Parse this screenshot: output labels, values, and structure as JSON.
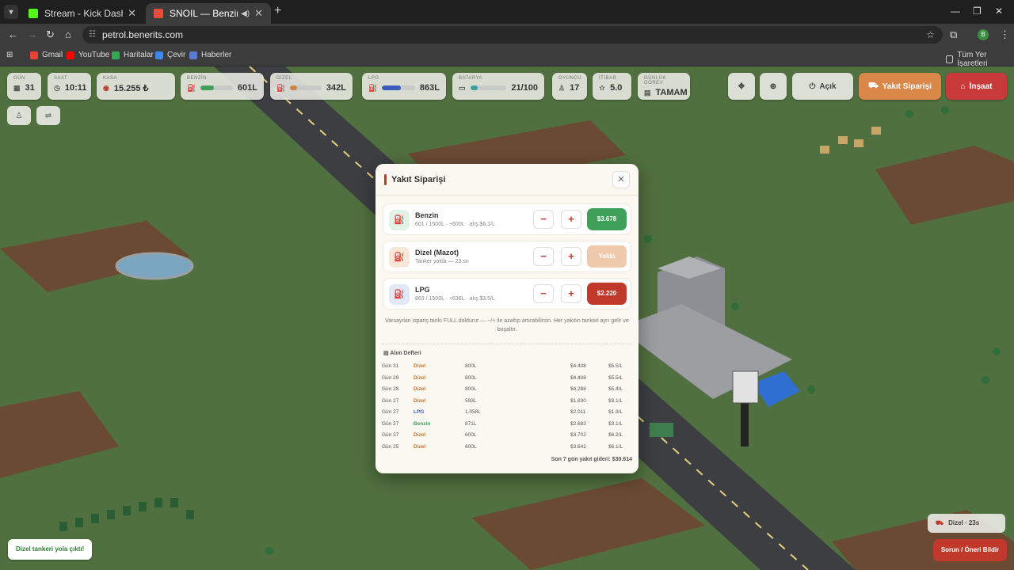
{
  "browser": {
    "tabs": [
      {
        "title": "Stream - Kick Dashboard",
        "active": false
      },
      {
        "title": "SNOIL — Benzinlik",
        "active": true
      }
    ],
    "url": "petrol.benerits.com",
    "profile_initial": "B",
    "bookmarks": [
      "Gmail",
      "YouTube",
      "Haritalar",
      "Çevir",
      "Haberler"
    ],
    "bookmarks_right": "Tüm Yer İşaretleri"
  },
  "hud": {
    "day": {
      "label": "GÜN",
      "value": "31"
    },
    "time": {
      "label": "SAAT",
      "value": "10:11"
    },
    "cash": {
      "label": "KASA",
      "value": "15.255 ₺"
    },
    "benzin": {
      "label": "BENZİN",
      "value": "601L",
      "level": 0.4,
      "color": "#3fa05a"
    },
    "dizel": {
      "label": "DİZEL",
      "value": "342L",
      "level": 0.23,
      "color": "#c8864a"
    },
    "lpg": {
      "label": "LPG",
      "value": "863L",
      "level": 0.58,
      "color": "#3b5bbf"
    },
    "battery": {
      "label": "BATARYA",
      "value": "21/100",
      "level": 0.21,
      "color": "#3ba0a0"
    },
    "players": {
      "label": "OYUNCU",
      "value": "17"
    },
    "reputation": {
      "label": "İTİBAR",
      "value": "5.0"
    },
    "daily": {
      "label": "GÜNLÜK GÖREV",
      "value": "TAMAM"
    },
    "open_label": "Açık",
    "fuel_order_label": "Yakıt Siparişi",
    "build_label": "İnşaat"
  },
  "modal": {
    "title": "Yakıt Siparişi",
    "fuels": [
      {
        "name": "Benzin",
        "sub": "601 / 1500L · +600L · alış $6.1/L",
        "buy": "$3.678",
        "buy_color": "#3fa05a",
        "icon_bg": "#e3f2e6"
      },
      {
        "name": "Dizel (Mazot)",
        "sub": "Tanker yolda — 23 sn",
        "buy": "Yolda",
        "buy_color": "#efc9ab",
        "icon_bg": "#f8e6d8"
      },
      {
        "name": "LPG",
        "sub": "863 / 1500L · +636L · alış $3.5/L",
        "buy": "$2.220",
        "buy_color": "#c0392b",
        "icon_bg": "#e3e8f6"
      }
    ],
    "note": "Varsayılan sipariş tankı FULL doldurur — −/+ ile azaltıp artırabilirsin. Her yakıtın tankeri ayrı gelir ve boşaltır.",
    "ledger_title": "Alım Defteri",
    "ledger": [
      {
        "day": "Gün 31",
        "fuel": "Dizel",
        "liters": "800L",
        "price": "$4.408",
        "unit": "$5.5/L"
      },
      {
        "day": "Gün 29",
        "fuel": "Dizel",
        "liters": "800L",
        "price": "$4.408",
        "unit": "$5.5/L"
      },
      {
        "day": "Gün 28",
        "fuel": "Dizel",
        "liters": "800L",
        "price": "$4.288",
        "unit": "$5.4/L"
      },
      {
        "day": "Gün 27",
        "fuel": "Dizel",
        "liters": "593L",
        "price": "$1.830",
        "unit": "$3.1/L"
      },
      {
        "day": "Gün 27",
        "fuel": "LPG",
        "liters": "1.058L",
        "price": "$2.011",
        "unit": "$1.9/L"
      },
      {
        "day": "Gün 27",
        "fuel": "Benzin",
        "liters": "871L",
        "price": "$2.683",
        "unit": "$3.1/L"
      },
      {
        "day": "Gün 27",
        "fuel": "Dizel",
        "liters": "600L",
        "price": "$3.702",
        "unit": "$6.2/L"
      },
      {
        "day": "Gün 25",
        "fuel": "Dizel",
        "liters": "600L",
        "price": "$3.642",
        "unit": "$6.1/L"
      }
    ],
    "fuel_colors": {
      "Dizel": "#c8742e",
      "LPG": "#3b5bbf",
      "Benzin": "#3fa05a"
    },
    "total": "Son 7 gün yakıt gideri: $30.614"
  },
  "toast": "Dizel tankeri yola çıktı!",
  "tanker_chip": "Dizel · 23s",
  "report_button": "Sorun / Öneri Bildir"
}
